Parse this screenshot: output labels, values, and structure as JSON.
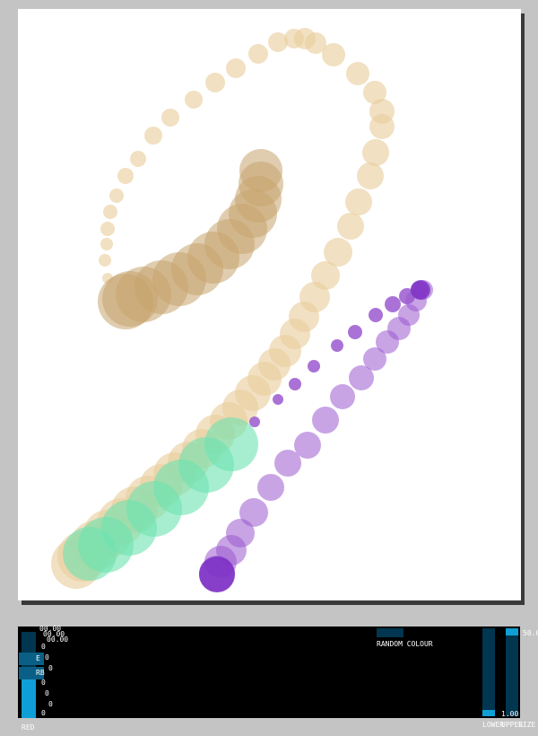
{
  "panel": {
    "channel_labels": [
      "RED",
      "E",
      "RB"
    ],
    "random_colour_label": "RANDOM COLOUR",
    "lower_label": "LOWER",
    "upper_label": "UPPER",
    "size_label": "SIZE",
    "lower_value": "1.00",
    "upper_value": "50.0",
    "top_values": [
      "00.00",
      "00.00",
      "00.00"
    ],
    "side_ticks": [
      "0",
      "0",
      "0",
      "0",
      "0",
      "0",
      "0"
    ]
  },
  "colors": {
    "tan_light": "#e9cf9f",
    "tan_dark": "#c6a46e",
    "green": "#6de3b0",
    "purple": "#9b59cf",
    "purple_dark": "#7b2ec4",
    "slider_fill": "#0f9fd6",
    "slider_bg": "#003650"
  }
}
